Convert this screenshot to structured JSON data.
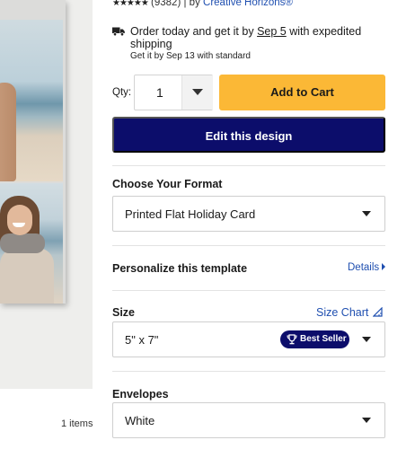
{
  "product": {
    "rating_stars": "★★★★★",
    "review_count": "(9382)",
    "by_prefix": "| by",
    "brand": "Creative Horizons®"
  },
  "delivery": {
    "text_before": "Order today and get it by",
    "date_expedited": "Sep 5",
    "text_after": "with expedited shipping",
    "standard": "Get it by Sep 13 with standard"
  },
  "purchase": {
    "qty_label": "Qty:",
    "qty_value": "1",
    "add_to_cart_label": "Add to Cart",
    "edit_design_label": "Edit this design"
  },
  "format": {
    "title": "Choose Your Format",
    "selected": "Printed Flat Holiday Card"
  },
  "personalize": {
    "title": "Personalize this template",
    "details_link": "Details"
  },
  "size": {
    "title": "Size",
    "chart_link": "Size Chart",
    "selected": "5\" x 7\"",
    "badge": "Best Seller"
  },
  "envelopes": {
    "title": "Envelopes",
    "selected": "White"
  },
  "preview": {
    "items_count": "1 items"
  },
  "colors": {
    "cta_yellow": "#fbb836",
    "primary_navy": "#0c0d6b",
    "link_blue": "#1f4fb0"
  },
  "icons": [
    "truck-icon",
    "chevron-down-icon",
    "chevron-right-icon",
    "ruler-icon",
    "trophy-icon"
  ]
}
